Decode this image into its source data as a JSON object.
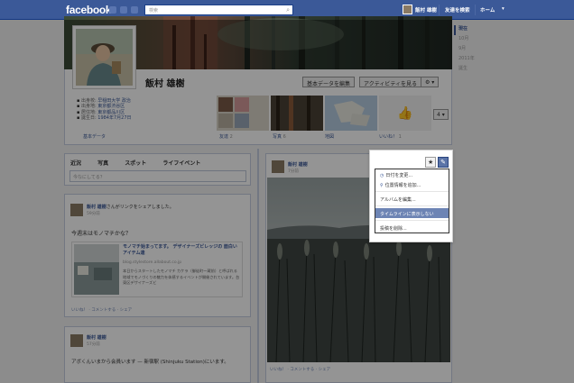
{
  "topbar": {
    "logo": "facebook",
    "search_placeholder": "検索",
    "user_name": "飯村 雄樹",
    "find_friends": "友達を検索",
    "home": "ホーム",
    "home_arrow": "▾"
  },
  "timeline_nav": {
    "items": [
      "現在",
      "10月",
      "9月",
      "2011年",
      "誕生"
    ]
  },
  "profile": {
    "name": "飯村 雄樹",
    "info": [
      {
        "icon": "school-icon",
        "key": "出身校:",
        "value": "早稲田大学 政治"
      },
      {
        "icon": "home-icon",
        "key": "出身地:",
        "value": "東京都渋谷区"
      },
      {
        "icon": "location-icon",
        "key": "居住地:",
        "value": "東京都品川区"
      },
      {
        "icon": "birthday-icon",
        "key": "誕生日:",
        "value": "1984年7月27日"
      }
    ],
    "about_link": "基本データ",
    "edit_button": "基本データを編集",
    "activity_button": "アクティビティを見る",
    "gear": "⚙ ▾",
    "more_button": "4 ▾"
  },
  "thumbs": [
    {
      "label": "友達",
      "count": "2"
    },
    {
      "label": "写真",
      "count": "6"
    },
    {
      "label": "地図",
      "count": ""
    },
    {
      "label": "いいね！",
      "count": "1"
    }
  ],
  "composer": {
    "tabs": [
      "近況",
      "写真",
      "スポット",
      "ライフイベント"
    ],
    "placeholder": "今なにしてる？"
  },
  "posts": [
    {
      "name": "飯村 雄樹",
      "suffix": "さんがリンクをシェアしました。",
      "time": "59分前",
      "text": "今週末はモノマチかな？",
      "link_title": "モノマチ始まってます。 デザイナーズビレッジの 面白いアイテム達",
      "link_url": "blog.stylestore.allabout.co.jp",
      "link_desc": "本日からスタートしたモノマチ カケラ（御徒町～蔵前）と呼ばれる地域でモノづくりの魅力を体感するイベントが開催されています。台東区デザイナーズビ",
      "actions": "いいね！ · コメントする · シェア"
    },
    {
      "name": "飯村 雄樹",
      "time": "57分前",
      "text": "アボくんいまから会員います — 新宿駅 (Shinjuku Station)にいます。"
    }
  ],
  "photo_post": {
    "name": "飯村 雄樹",
    "time": "7分前",
    "actions": "いいね！ · コメントする · シェア"
  },
  "menu": {
    "star": "★",
    "pencil": "✎",
    "items": [
      {
        "label": "日付を変更...",
        "icon": "◷",
        "highlighted": false
      },
      {
        "label": "位置情報を追加...",
        "icon": "⚲",
        "highlighted": false
      },
      {
        "label": "アルバムを編集...",
        "icon": "",
        "highlighted": false
      },
      {
        "label": "タイムラインに表示しない",
        "icon": "",
        "highlighted": true
      },
      {
        "label": "投稿を削除...",
        "icon": "",
        "highlighted": false
      }
    ]
  },
  "colors": {
    "brand": "#3b5998",
    "highlight": "#6d84b4"
  }
}
